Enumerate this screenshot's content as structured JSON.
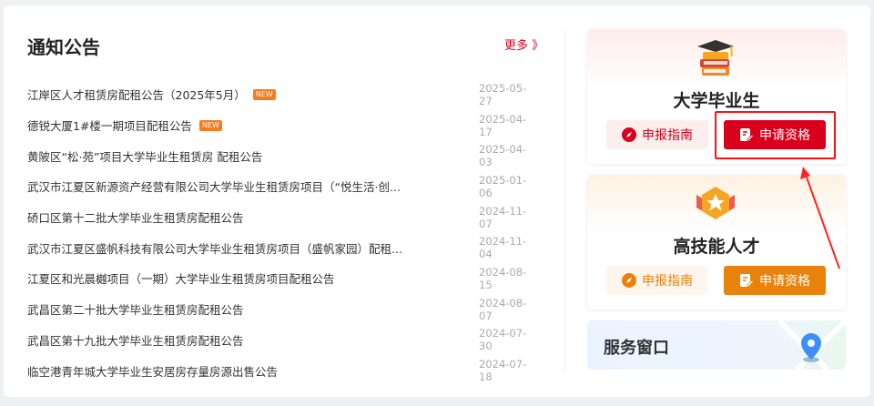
{
  "notices": {
    "title": "通知公告",
    "more": "更多 》",
    "new_badge": "NEW",
    "items": [
      {
        "title": "江岸区人才租赁房配租公告（2025年5月）",
        "date": "2025-05-27",
        "new": true
      },
      {
        "title": "德锐大厦1#楼一期项目配租公告",
        "date": "2025-04-17",
        "new": true
      },
      {
        "title": "黄陂区“松·苑”项目大学毕业生租赁房 配租公告",
        "date": "2025-04-03",
        "new": false
      },
      {
        "title": "武汉市江夏区新源资产经营有限公司大学毕业生租赁房项目（“悦生活·创...",
        "date": "2025-01-06",
        "new": false
      },
      {
        "title": "硚口区第十二批大学毕业生租赁房配租公告",
        "date": "2024-11-07",
        "new": false
      },
      {
        "title": "武汉市江夏区盛帆科技有限公司大学毕业生租赁房项目（盛帆家园）配租...",
        "date": "2024-11-04",
        "new": false
      },
      {
        "title": "江夏区和光晨樾项目（一期）大学毕业生租赁房项目配租公告",
        "date": "2024-08-15",
        "new": false
      },
      {
        "title": "武昌区第二十批大学毕业生租赁房配租公告",
        "date": "2024-08-07",
        "new": false
      },
      {
        "title": "武昌区第十九批大学毕业生租赁房配租公告",
        "date": "2024-07-30",
        "new": false
      },
      {
        "title": "临空港青年城大学毕业生安居房存量房源出售公告",
        "date": "2024-07-18",
        "new": false
      }
    ]
  },
  "cards": [
    {
      "title": "大学毕业生",
      "guide": "申报指南",
      "apply": "申请资格",
      "icon": "graduation-books-icon",
      "color": "#d9001b"
    },
    {
      "title": "高技能人才",
      "guide": "申报指南",
      "apply": "申请资格",
      "icon": "star-medal-icon",
      "color": "#e8820c"
    }
  ],
  "service": {
    "title": "服务窗口",
    "icon": "map-pin-icon"
  }
}
